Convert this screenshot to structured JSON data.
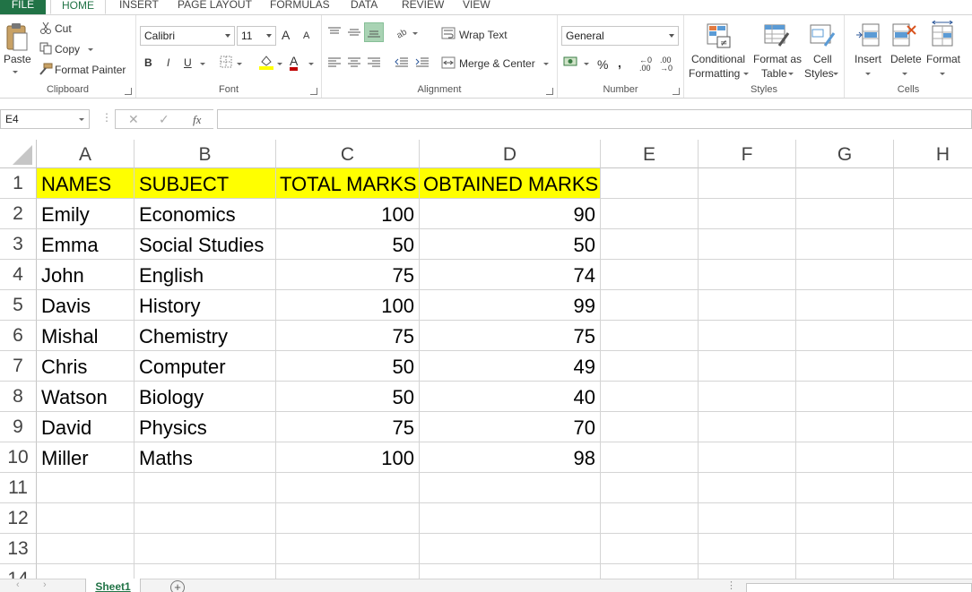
{
  "ribbon_tabs": [
    {
      "label": "FILE"
    },
    {
      "label": "HOME"
    },
    {
      "label": "INSERT"
    },
    {
      "label": "PAGE LAYOUT"
    },
    {
      "label": "FORMULAS"
    },
    {
      "label": "DATA"
    },
    {
      "label": "REVIEW"
    },
    {
      "label": "VIEW"
    }
  ],
  "clipboard": {
    "paste": "Paste",
    "cut": "Cut",
    "copy": "Copy",
    "format_painter": "Format Painter",
    "label": "Clipboard"
  },
  "font": {
    "name": "Calibri",
    "size": "11",
    "bold": "B",
    "italic": "I",
    "underline": "U",
    "grow": "A",
    "shrink": "A",
    "font_color": "A",
    "label": "Font"
  },
  "alignment": {
    "wrap_text": "Wrap Text",
    "merge_center": "Merge & Center",
    "label": "Alignment"
  },
  "number": {
    "format": "General",
    "percent": "%",
    "comma": ",",
    "inc_decimal": "←0 .00",
    "dec_decimal": ".00 →0",
    "label": "Number"
  },
  "styles": {
    "conditional_1": "Conditional",
    "conditional_2": "Formatting",
    "format_table_1": "Format as",
    "format_table_2": "Table",
    "cell_styles_1": "Cell",
    "cell_styles_2": "Styles",
    "label": "Styles"
  },
  "cells": {
    "insert": "Insert",
    "delete": "Delete",
    "format": "Format",
    "label": "Cells"
  },
  "formula_bar": {
    "name_box": "E4",
    "cancel": "✕",
    "enter": "✓",
    "fx": "fx",
    "value": ""
  },
  "columns": [
    "A",
    "B",
    "C",
    "D",
    "E",
    "F",
    "G",
    "H"
  ],
  "rows": [
    "1",
    "2",
    "3",
    "4",
    "5",
    "6",
    "7",
    "8",
    "9",
    "10",
    "11",
    "12",
    "13",
    "14"
  ],
  "table": {
    "headers": [
      "NAMES",
      "SUBJECT",
      "TOTAL MARKS",
      "OBTAINED MARKS"
    ],
    "data": [
      [
        "Emily",
        "Economics",
        "100",
        "90"
      ],
      [
        "Emma",
        "Social Studies",
        "50",
        "50"
      ],
      [
        "John",
        "English",
        "75",
        "74"
      ],
      [
        "Davis",
        "History",
        "100",
        "99"
      ],
      [
        "Mishal",
        "Chemistry",
        "75",
        "75"
      ],
      [
        "Chris",
        "Computer",
        "50",
        "49"
      ],
      [
        "Watson",
        "Biology",
        "50",
        "40"
      ],
      [
        "David",
        "Physics",
        "75",
        "70"
      ],
      [
        "Miller",
        "Maths",
        "100",
        "98"
      ]
    ]
  },
  "sheet_tabs": [
    {
      "label": "Sheet1"
    }
  ],
  "colors": {
    "accent": "#217346",
    "header_fill": "#ffff00",
    "grid_line": "#d4d4d4"
  }
}
